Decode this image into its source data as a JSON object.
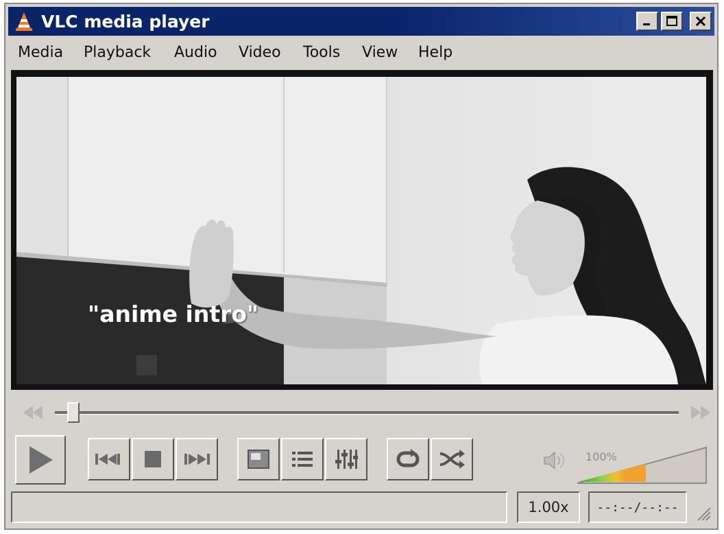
{
  "window": {
    "title": "VLC media player",
    "controls": {
      "minimize": "minimize",
      "maximize": "maximize",
      "close": "close"
    }
  },
  "menu": [
    "Media",
    "Playback",
    "Audio",
    "Video",
    "Tools",
    "View",
    "Help"
  ],
  "video": {
    "subtitle": "\"anime intro\""
  },
  "seek": {
    "position_fraction": 0.02
  },
  "controls": {
    "icons": {
      "play": "play-icon",
      "previous": "previous-icon",
      "stop": "stop-icon",
      "next": "next-icon",
      "fullscreen": "fullscreen-icon",
      "playlist": "playlist-icon",
      "extended": "equalizer-icon",
      "loop": "loop-icon",
      "shuffle": "shuffle-icon",
      "volume": "speaker-icon"
    }
  },
  "volume": {
    "label": "100%",
    "level_percent": 100
  },
  "status": {
    "text": "",
    "speed": "1.00x",
    "time": "--:--/--:--"
  },
  "colors": {
    "titlebar": "#0a246a",
    "window_bg": "#d6d3ce",
    "volume_low": "#4caf2a",
    "volume_high": "#f2a12e"
  }
}
